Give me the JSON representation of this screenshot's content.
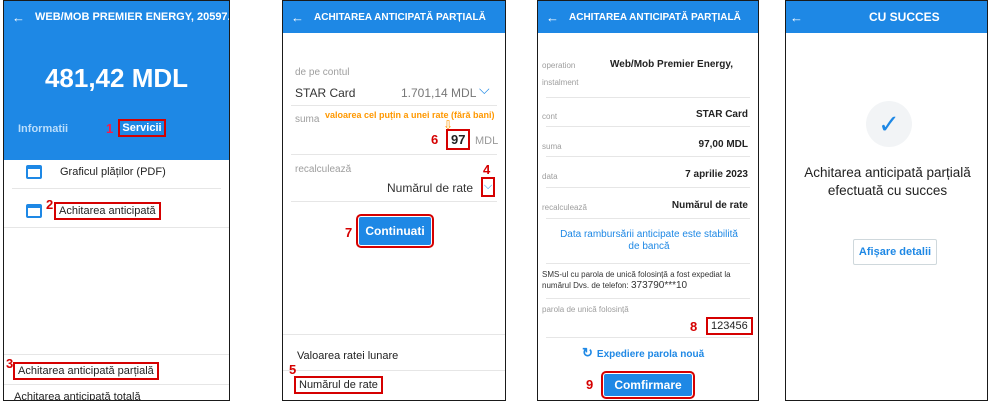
{
  "panel1": {
    "header_title": "WEB/MOB PREMIER ENERGY, 20597...",
    "amount": "481,42 MDL",
    "tab_info": "Informatii",
    "tab_services": "Servicii",
    "menu_schedule": "Graficul plăților (PDF)",
    "menu_anticipated": "Achitarea anticipată",
    "opt_partial": "Achitarea anticipată parțială",
    "opt_total": "Achitarea anticipată totală",
    "step1": "1",
    "step2": "2",
    "step3": "3"
  },
  "panel2": {
    "header_title": "ACHITAREA ANTICIPATĂ PARȚIALĂ",
    "from_label": "de pe contul",
    "account": "STAR Card",
    "balance": "1.701,14 MDL",
    "sum_label": "suma",
    "hint": "valoarea cel puțin a unei rate (fără bani)",
    "sum_value": "97",
    "currency": "MDL",
    "recalc_label": "recalculează",
    "recalc_value": "Numărul de rate",
    "continue_btn": "Continuati",
    "opt_monthly": "Valoarea ratei lunare",
    "opt_count": "Numărul de rate",
    "step4": "4",
    "step5": "5",
    "step6": "6",
    "step7": "7"
  },
  "panel3": {
    "header_title": "ACHITAREA ANTICIPATĂ PARȚIALĂ",
    "operation_label": "operation",
    "instalment_label": "instalment",
    "operation_value": "Web/Mob Premier Energy,",
    "cont_label": "cont",
    "cont_value": "STAR Card",
    "suma_label": "suma",
    "suma_value": "97,00 MDL",
    "data_label": "data",
    "data_value": "7 aprilie 2023",
    "recalc_label": "recalculează",
    "recalc_value": "Numărul de rate",
    "repay_date_note": "Data rambursării anticipate este stabilită de bancă",
    "sms_note": "SMS-ul cu parola de unică folosință a fost expediat la numărul Dvs. de telefon:",
    "phone": "373790***10",
    "otp_label": "parola de unică folosință",
    "otp_value": "123456",
    "resend": "Expediere parola nouă",
    "confirm_btn": "Comfirmare",
    "step8": "8",
    "step9": "9"
  },
  "panel4": {
    "header_title": "CU SUCCES",
    "message": "Achitarea anticipată parțială efectuată cu succes",
    "details_btn": "Afișare detalii"
  },
  "colors": {
    "primary": "#1e88e5",
    "annotation": "#d50000",
    "hint": "#ff9800"
  }
}
